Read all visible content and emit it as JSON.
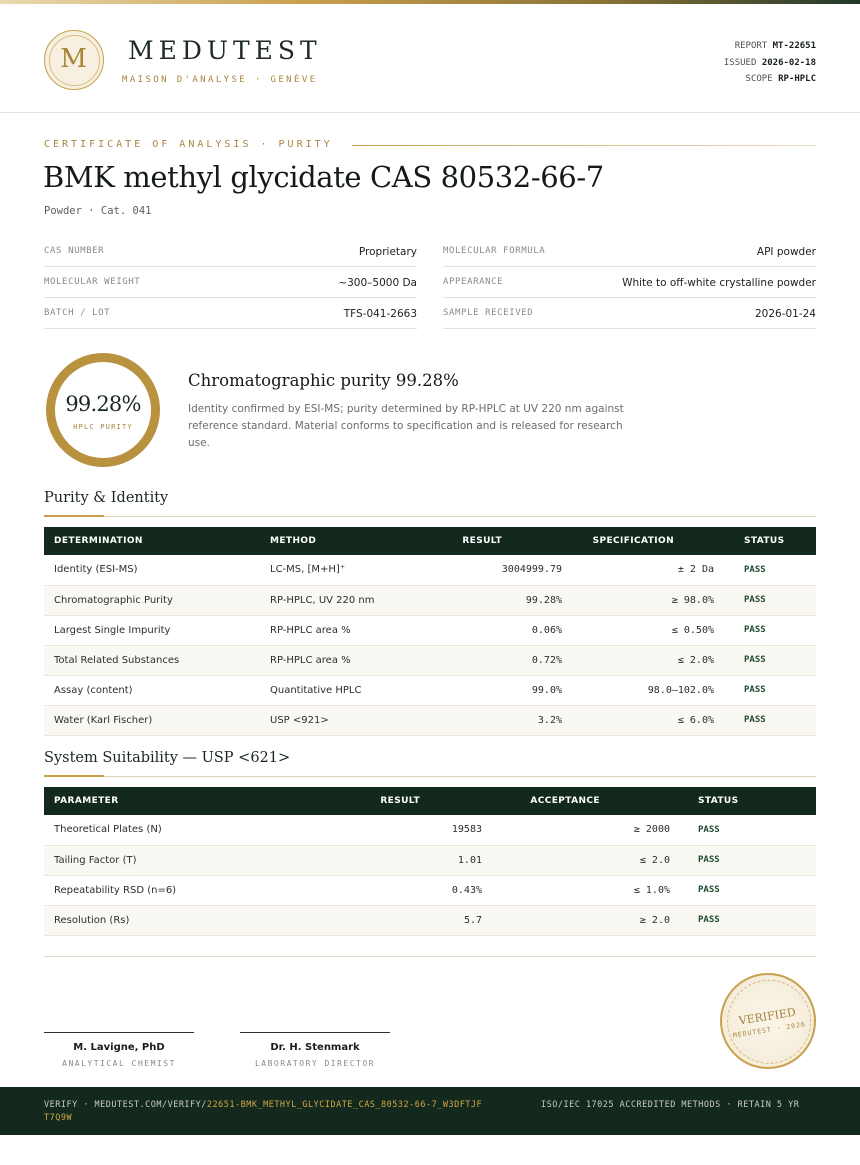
{
  "header": {
    "logo_letter": "M",
    "brand_name": "MEDUTEST",
    "brand_tagline": "MAISON D'ANALYSE · GENÈVE",
    "report_label": "REPORT",
    "report_value": "MT-22651",
    "issued_label": "ISSUED",
    "issued_value": "2026-02-18",
    "scope_label": "SCOPE",
    "scope_value": "RP-HPLC"
  },
  "title": {
    "kicker": "CERTIFICATE OF ANALYSIS · PURITY",
    "product_name": "BMK methyl glycidate CAS 80532-66-7",
    "subtitle": "Powder  ·  Cat. 041"
  },
  "specs": {
    "left": [
      {
        "label": "CAS NUMBER",
        "value": "Proprietary"
      },
      {
        "label": "MOLECULAR WEIGHT",
        "value": "~300–5000 Da"
      },
      {
        "label": "BATCH / LOT",
        "value": "TFS-041-2663"
      }
    ],
    "right": [
      {
        "label": "MOLECULAR FORMULA",
        "value": "API powder"
      },
      {
        "label": "APPEARANCE",
        "value": "White to off-white crystalline powder"
      },
      {
        "label": "SAMPLE RECEIVED",
        "value": "2026-01-24"
      }
    ]
  },
  "purity": {
    "value": "99.28%",
    "caption": "HPLC PURITY",
    "heading": "Chromatographic purity 99.28%",
    "description": "Identity confirmed by ESI-MS; purity determined by RP-HPLC at UV 220 nm against reference standard. Material conforms to specification and is released for research use."
  },
  "purity_identity": {
    "title": "Purity & Identity",
    "headers": [
      "DETERMINATION",
      "METHOD",
      "RESULT",
      "SPECIFICATION",
      "STATUS"
    ],
    "rows": [
      {
        "determination": "Identity (ESI-MS)",
        "method": "LC-MS, [M+H]⁺",
        "result": "3004999.79",
        "specification": "± 2 Da",
        "status": "PASS"
      },
      {
        "determination": "Chromatographic Purity",
        "method": "RP-HPLC, UV 220 nm",
        "result": "99.28%",
        "specification": "≥ 98.0%",
        "status": "PASS"
      },
      {
        "determination": "Largest Single Impurity",
        "method": "RP-HPLC area %",
        "result": "0.06%",
        "specification": "≤ 0.50%",
        "status": "PASS"
      },
      {
        "determination": "Total Related Substances",
        "method": "RP-HPLC area %",
        "result": "0.72%",
        "specification": "≤ 2.0%",
        "status": "PASS"
      },
      {
        "determination": "Assay (content)",
        "method": "Quantitative HPLC",
        "result": "99.0%",
        "specification": "98.0–102.0%",
        "status": "PASS"
      },
      {
        "determination": "Water (Karl Fischer)",
        "method": "USP <921>",
        "result": "3.2%",
        "specification": "≤ 6.0%",
        "status": "PASS"
      }
    ]
  },
  "system_suitability": {
    "title": "System Suitability — USP <621>",
    "headers": [
      "PARAMETER",
      "RESULT",
      "ACCEPTANCE",
      "STATUS"
    ],
    "rows": [
      {
        "parameter": "Theoretical Plates (N)",
        "result": "19583",
        "acceptance": "≥ 2000",
        "status": "PASS"
      },
      {
        "parameter": "Tailing Factor (T)",
        "result": "1.01",
        "acceptance": "≤ 2.0",
        "status": "PASS"
      },
      {
        "parameter": "Repeatability RSD (n=6)",
        "result": "0.43%",
        "acceptance": "≤ 1.0%",
        "status": "PASS"
      },
      {
        "parameter": "Resolution (Rs)",
        "result": "5.7",
        "acceptance": "≥ 2.0",
        "status": "PASS"
      }
    ]
  },
  "signatures": [
    {
      "name": "M. Lavigne, PhD",
      "role": "ANALYTICAL CHEMIST"
    },
    {
      "name": "Dr. H. Stenmark",
      "role": "LABORATORY DIRECTOR"
    }
  ],
  "stamp": {
    "word": "VERIFIED",
    "sub": "MEDUTEST · 2026"
  },
  "footer": {
    "verify_prefix": "VERIFY · MEDUTEST.COM/VERIFY/",
    "verify_code": "22651-BMK_METHYL_GLYCIDATE_CAS_80532-66-7_W3DFTJFT7Q9W",
    "accreditation": "ISO/IEC 17025 ACCREDITED METHODS · RETAIN 5 YR"
  }
}
